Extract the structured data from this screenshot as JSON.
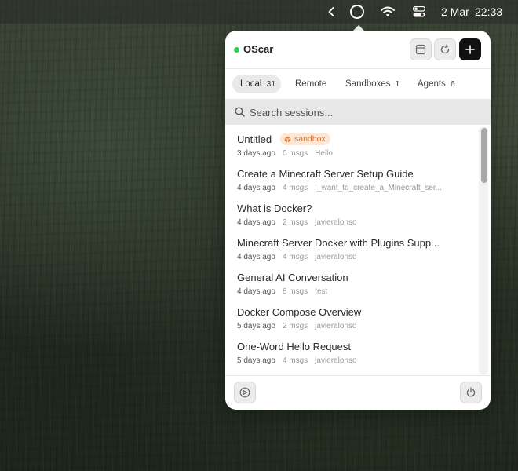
{
  "menubar": {
    "date": "2 Mar",
    "time": "22:33",
    "icons": [
      "chevron-left-icon",
      "oscar-ring-icon",
      "wifi-icon",
      "control-center-icon"
    ]
  },
  "app": {
    "title": "OScar",
    "status_color": "#34c759",
    "header_buttons": [
      "archive-icon",
      "refresh-icon",
      "plus-icon"
    ]
  },
  "tabs": [
    {
      "label": "Local",
      "count": "31",
      "active": true
    },
    {
      "label": "Remote",
      "count": "",
      "active": false
    },
    {
      "label": "Sandboxes",
      "count": "1",
      "active": false
    },
    {
      "label": "Agents",
      "count": "6",
      "active": false
    }
  ],
  "search": {
    "placeholder": "Search sessions..."
  },
  "sessions": [
    {
      "title": "Untitled",
      "time": "3 days ago",
      "msgs": "0 msgs",
      "user": "Hello",
      "badge": "sandbox"
    },
    {
      "title": "Create a Minecraft Server Setup Guide",
      "time": "4 days ago",
      "msgs": "4 msgs",
      "user": "I_want_to_create_a_Minecraft_ser..."
    },
    {
      "title": "What is Docker?",
      "time": "4 days ago",
      "msgs": "2 msgs",
      "user": "javieralonso"
    },
    {
      "title": "Minecraft Server Docker with Plugins Supp...",
      "time": "4 days ago",
      "msgs": "4 msgs",
      "user": "javieralonso"
    },
    {
      "title": "General AI Conversation",
      "time": "4 days ago",
      "msgs": "8 msgs",
      "user": "test"
    },
    {
      "title": "Docker Compose Overview",
      "time": "5 days ago",
      "msgs": "2 msgs",
      "user": "javieralonso"
    },
    {
      "title": "One-Word Hello Request",
      "time": "5 days ago",
      "msgs": "4 msgs",
      "user": "javieralonso"
    }
  ],
  "colors": {
    "accent": "#111111",
    "badge_bg": "#fde8d8",
    "badge_fg": "#d9702a"
  },
  "footer_buttons": [
    "settings-icon",
    "power-icon"
  ]
}
